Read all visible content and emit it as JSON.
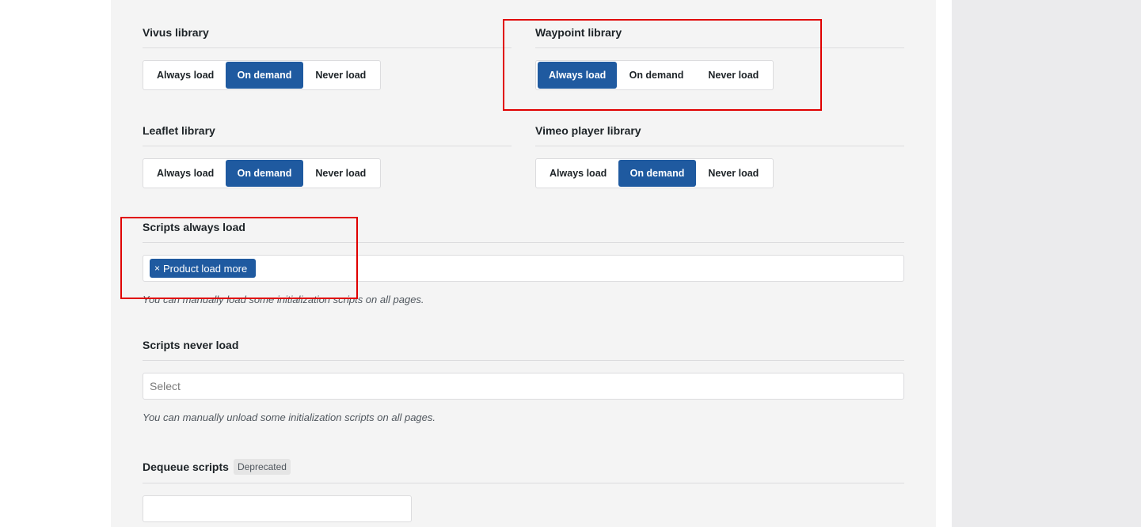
{
  "vivus": {
    "title": "Vivus library",
    "options": [
      "Always load",
      "On demand",
      "Never load"
    ],
    "selected": 1
  },
  "waypoint": {
    "title": "Waypoint library",
    "options": [
      "Always load",
      "On demand",
      "Never load"
    ],
    "selected": 0
  },
  "leaflet": {
    "title": "Leaflet library",
    "options": [
      "Always load",
      "On demand",
      "Never load"
    ],
    "selected": 1
  },
  "vimeo": {
    "title": "Vimeo player library",
    "options": [
      "Always load",
      "On demand",
      "Never load"
    ],
    "selected": 1
  },
  "scripts_always": {
    "title": "Scripts always load",
    "tags": [
      "Product load more"
    ],
    "remove_glyph": "×",
    "help": "You can manually load some initialization scripts on all pages."
  },
  "scripts_never": {
    "title": "Scripts never load",
    "placeholder": "Select",
    "help": "You can manually unload some initialization scripts on all pages."
  },
  "dequeue": {
    "title": "Dequeue scripts",
    "badge": "Deprecated",
    "value": ""
  },
  "colors": {
    "accent": "#1f5aa0",
    "highlight": "#e00000"
  }
}
